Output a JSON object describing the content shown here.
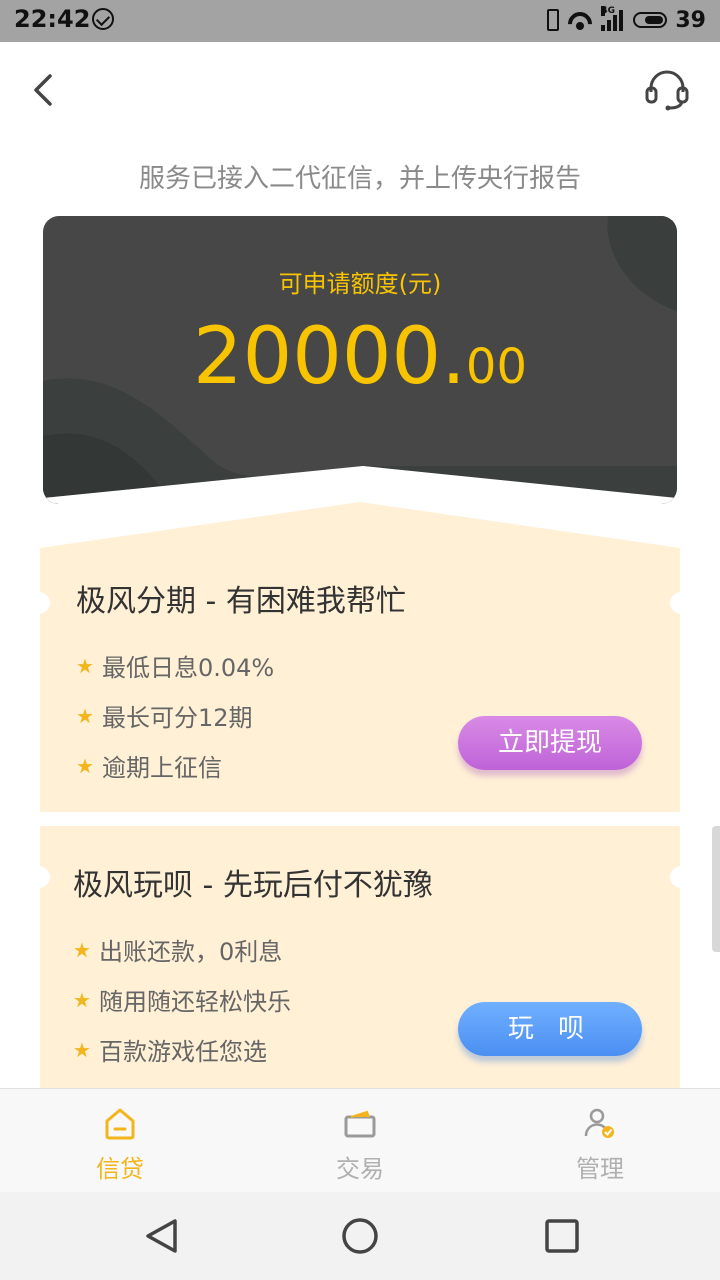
{
  "status_bar": {
    "time": "22:42",
    "battery": "39",
    "network": "4G"
  },
  "header": {
    "back_icon": "chevron-left-icon",
    "service_icon": "headset-icon"
  },
  "notice": "服务已接入二代征信，并上传央行报告",
  "quota": {
    "label": "可申请额度(元)",
    "amount_int": "20000.",
    "amount_dec": "00",
    "color": "#f8c400",
    "card_color": "#474747"
  },
  "products": [
    {
      "title": "极风分期 - 有困难我帮忙",
      "features": [
        "最低日息0.04%",
        "最长可分12期",
        "逾期上征信"
      ],
      "button": "立即提现",
      "button_color": "#c56ddb"
    },
    {
      "title": "极风玩呗 - 先玩后付不犹豫",
      "features": [
        "出账还款，0利息",
        "随用随还轻松快乐",
        "百款游戏任您选"
      ],
      "button": "玩 呗",
      "button_color": "#5a9bf7"
    }
  ],
  "bottom_nav": [
    {
      "label": "信贷",
      "icon": "home-icon",
      "active": true
    },
    {
      "label": "交易",
      "icon": "wallet-icon",
      "active": false
    },
    {
      "label": "管理",
      "icon": "user-check-icon",
      "active": false
    }
  ],
  "accent_color": "#f3b51b",
  "card_bg_color": "#fff0d6"
}
